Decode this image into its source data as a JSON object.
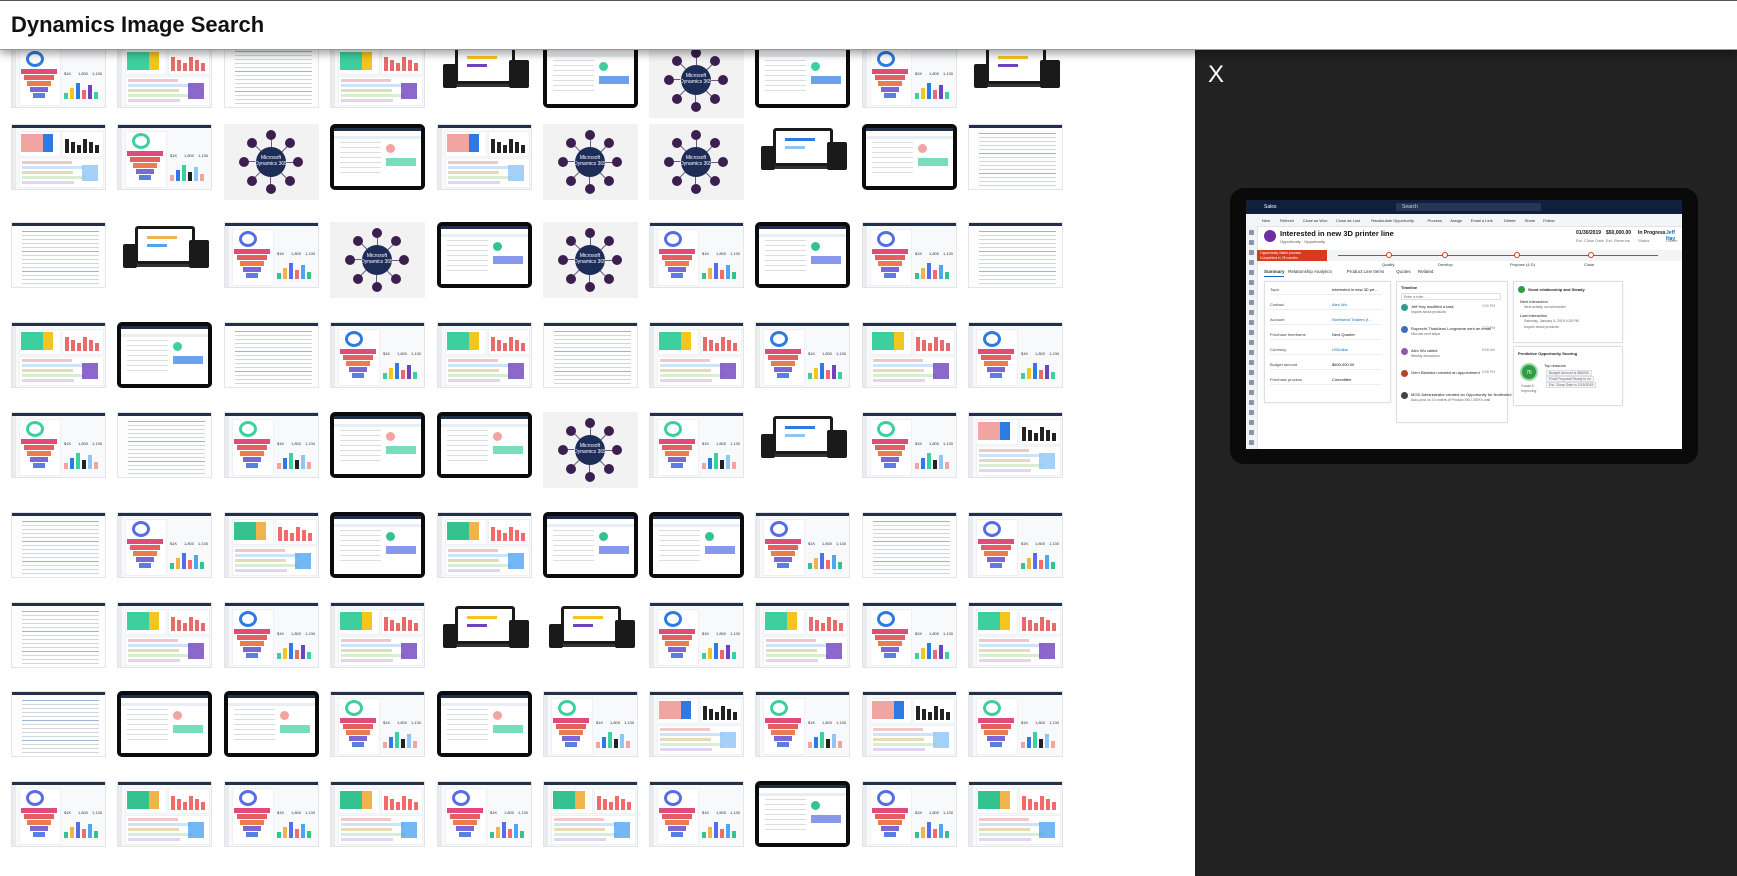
{
  "header": {
    "title": "Dynamics Image Search"
  },
  "viewer": {
    "close_label": "X",
    "app_name": "Sales",
    "search_placeholder": "Search",
    "commands": [
      "New",
      "Refresh",
      "Close as Won",
      "Close as Lost",
      "Recalculate Opportunity",
      "Process",
      "Assign",
      "Email a Link",
      "Delete",
      "Share",
      "Follow"
    ],
    "record": {
      "title": "Interested in new 3D printer line",
      "subtitle": "Opportunity · Opportunity",
      "header_fields": [
        {
          "value": "01/30/2019",
          "label": "Est. Close Date"
        },
        {
          "value": "$50,000.00",
          "label": "Est. Revenue"
        },
        {
          "value": "In Progress",
          "label": "Status"
        },
        {
          "value": "Jeff Hay",
          "label": "Owner"
        }
      ]
    },
    "process": {
      "active_name": "Opportunity Sales process",
      "active_sub": "Completed in 78 months",
      "stages": [
        "Qualify",
        "Develop",
        "Propose (4 D)",
        "Close"
      ]
    },
    "tabs": [
      "Summary",
      "Relationship Analytics",
      "Product Line Items",
      "Quotes",
      "Related"
    ],
    "fields": [
      {
        "label": "Topic",
        "value": "Interested in new 3D pri..."
      },
      {
        "label": "Contact",
        "value": "Alex Wu"
      },
      {
        "label": "Account",
        "value": "Northwind Traders (f..."
      },
      {
        "label": "Purchase timeframe",
        "value": "Next Quarter"
      },
      {
        "label": "Currency",
        "value": "USDollar"
      },
      {
        "label": "Budget amount",
        "value": "$600,000.00"
      },
      {
        "label": "Purchase process",
        "value": "Committee"
      }
    ],
    "timeline": {
      "title": "Timeline",
      "note_placeholder": "Enter a note...",
      "items": [
        {
          "title": "Jeff Hay modified a task",
          "sub": "Inquire about products",
          "time": "3:50 PM",
          "color": "#2a9d8f"
        },
        {
          "title": "Ruprecht Thaddeus Longname sent an email",
          "sub": "Discuss next steps",
          "time": "3:22 PM",
          "color": "#3f6fb5"
        },
        {
          "title": "Alex Wu called",
          "sub": "Weekly discussion",
          "time": "8:58 AM",
          "color": "#8e5aa8"
        },
        {
          "title": "Gern Blanston created an appointment",
          "sub": "",
          "time": "5:58 PM",
          "color": "#b4452b"
        },
        {
          "title": "MOD Administrator created an Opportunity for Northwind Traders",
          "sub": "Auto-post on 10 orders of Product SKU J39X's wall",
          "time": "",
          "color": "#444444"
        }
      ]
    },
    "relationship": {
      "title": "Good relationship and Steady",
      "next_label": "Next interaction",
      "next_value": "Next activity not scheduled",
      "last_label": "Last interaction",
      "last_value": "Saturday, January 5, 2019 4:26 PM",
      "last_sub": "Inquire about products"
    },
    "scoring": {
      "title": "Predictive Opportunity Scoring",
      "score": "76",
      "grade": "Grade A",
      "trend": "Improving",
      "reasons_title": "Top reasons",
      "reasons": [
        "Budget Amount is $60000",
        "Final Proposal Ready is no",
        "Est. Close Date is 2/15/2019"
      ]
    }
  },
  "gallery": {
    "thumbs_label": "Microsoft Dynamics 365"
  }
}
